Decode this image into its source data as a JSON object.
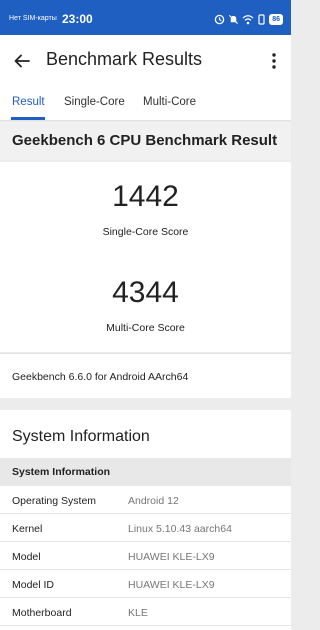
{
  "status_bar": {
    "carrier": "Нет SIM-карты",
    "time": "23:00",
    "battery": "86",
    "icons": [
      "data-saver-icon",
      "mute-icon",
      "wifi-icon",
      "vibrate-icon",
      "battery-icon"
    ]
  },
  "app_bar": {
    "title": "Benchmark Results",
    "back_icon": "arrow-left-icon",
    "menu_icon": "more-vertical-icon"
  },
  "tabs": [
    {
      "label": "Result",
      "active": true
    },
    {
      "label": "Single-Core",
      "active": false
    },
    {
      "label": "Multi-Core",
      "active": false
    }
  ],
  "benchmark": {
    "title": "Geekbench 6 CPU Benchmark Result",
    "single_core_score": "1442",
    "single_core_label": "Single-Core Score",
    "multi_core_score": "4344",
    "multi_core_label": "Multi-Core Score",
    "version": "Geekbench 6.6.0 for Android AArch64"
  },
  "system_information": {
    "title": "System Information",
    "subheader": "System Information",
    "rows": [
      {
        "key": "Operating System",
        "value": "Android 12"
      },
      {
        "key": "Kernel",
        "value": "Linux 5.10.43 aarch64"
      },
      {
        "key": "Model",
        "value": "HUAWEI KLE-LX9"
      },
      {
        "key": "Model ID",
        "value": "HUAWEI KLE-LX9"
      },
      {
        "key": "Motherboard",
        "value": "KLE"
      }
    ]
  },
  "colors": {
    "accent": "#1f5fc2",
    "status_bar": "#1f5fc2",
    "background": "#ececec"
  }
}
